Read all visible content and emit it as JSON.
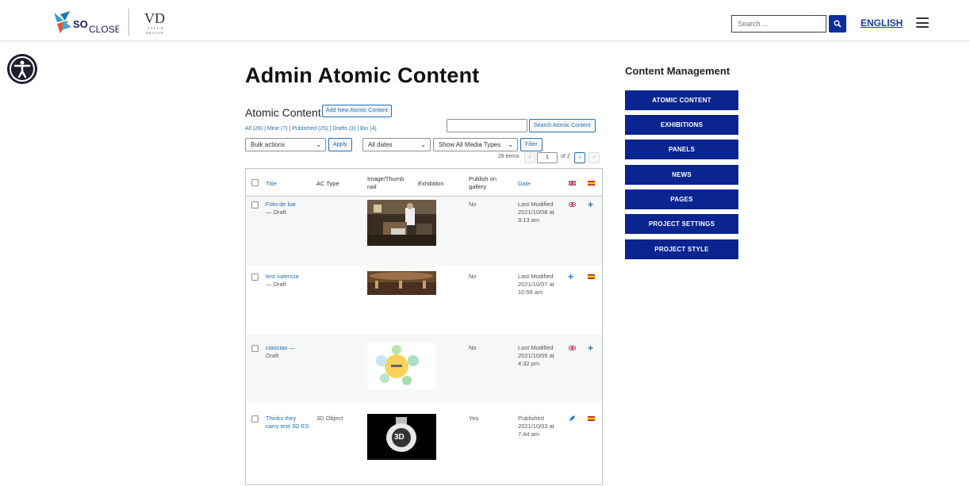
{
  "header": {
    "brand_text": "SOCLOSE",
    "vd_mark": "VD",
    "vd_text": "VILLA DECIUS",
    "search_placeholder": "Search ...",
    "language": "ENGLISH"
  },
  "page": {
    "title": "Admin Atomic Content"
  },
  "list": {
    "section_title": "Atomic Content",
    "add_new_label": "Add New Atomic Content",
    "views": [
      {
        "label": "All",
        "count": "(28)"
      },
      {
        "label": "Mine",
        "count": "(7)"
      },
      {
        "label": "Published",
        "count": "(25)"
      },
      {
        "label": "Drafts",
        "count": "(3)"
      },
      {
        "label": "Bin",
        "count": "(4)"
      }
    ],
    "search_button": "Search Atomic Content",
    "bulk_actions": "Bulk actions",
    "apply": "Apply",
    "all_dates": "All dates",
    "media_types": "Show All Media Types",
    "filter": "Filter",
    "items_count": "28 items",
    "current_page": "1",
    "of_pages": "of 2",
    "pager": {
      "first": "«",
      "prev": "‹",
      "next": "›",
      "last": "»"
    }
  },
  "table": {
    "headers": {
      "title": "Title",
      "ac_type": "AC Type",
      "image": "Image/Thumb nail",
      "exhibition": "Exhibition",
      "publish": "Publish on gallery",
      "date": "Date"
    },
    "rows": [
      {
        "title": "Foto de bar",
        "status": "— Draft",
        "ac_type": "",
        "publish": "No",
        "date_state": "Last Modified",
        "date": "2021/10/08 at 9:13 am",
        "col_en": "flag",
        "col_es": "plus"
      },
      {
        "title": "test valencia",
        "status": "— Draft",
        "ac_type": "",
        "publish": "No",
        "date_state": "Last Modified",
        "date": "2021/10/07 at 10:56 am",
        "col_en": "plus",
        "col_es": "flag"
      },
      {
        "title": "ciaociao —",
        "status": "Draft",
        "ac_type": "",
        "publish": "No",
        "date_state": "Last Modified",
        "date": "2021/10/05 at 4:32 pm",
        "col_en": "flag",
        "col_es": "plus"
      },
      {
        "title": "Thinks they carry test 3D ES",
        "status": "",
        "ac_type": "3D Object",
        "publish": "Yes",
        "date_state": "Published",
        "date": "2021/10/03 at 7:44 am",
        "col_en": "pencil",
        "col_es": "flag",
        "thumb_label": "3D"
      }
    ]
  },
  "sidebar": {
    "title": "Content Management",
    "items": [
      "ATOMIC CONTENT",
      "EXHIBITIONS",
      "PANELS",
      "NEWS",
      "PAGES",
      "PROJECT SETTINGS",
      "PROJECT STYLE"
    ]
  },
  "colors": {
    "accent": "#0a2490",
    "link": "#2271b1"
  }
}
